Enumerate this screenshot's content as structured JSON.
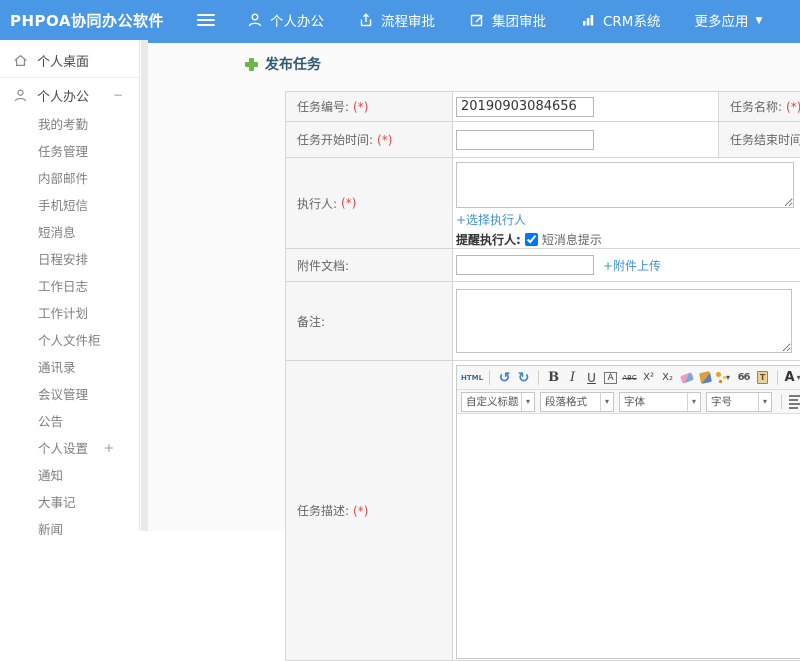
{
  "header": {
    "logo": "PHPOA协同办公软件",
    "nav": [
      {
        "label": "个人办公",
        "icon": "person-icon"
      },
      {
        "label": "流程审批",
        "icon": "approval-flow-icon"
      },
      {
        "label": "集团审批",
        "icon": "group-approval-icon"
      },
      {
        "label": "CRM系统",
        "icon": "bar-chart-icon"
      },
      {
        "label": "更多应用",
        "icon": "caret-down-icon"
      }
    ]
  },
  "sidebar": {
    "items": [
      {
        "label": "个人桌面",
        "icon": "home",
        "level": 0
      },
      {
        "label": "个人办公",
        "icon": "person",
        "level": 0,
        "toggle": "−"
      },
      {
        "label": "我的考勤",
        "level": 1
      },
      {
        "label": "任务管理",
        "level": 1
      },
      {
        "label": "内部邮件",
        "level": 1
      },
      {
        "label": "手机短信",
        "level": 1
      },
      {
        "label": "短消息",
        "level": 1
      },
      {
        "label": "日程安排",
        "level": 1
      },
      {
        "label": "工作日志",
        "level": 1
      },
      {
        "label": "工作计划",
        "level": 1
      },
      {
        "label": "个人文件柜",
        "level": 1
      },
      {
        "label": "通讯录",
        "level": 1
      },
      {
        "label": "会议管理",
        "level": 1
      },
      {
        "label": "公告",
        "level": 1
      },
      {
        "label": "个人设置",
        "level": 1,
        "toggle": "+"
      },
      {
        "label": "通知",
        "level": 1
      },
      {
        "label": "大事记",
        "level": 1
      },
      {
        "label": "新闻",
        "level": 1
      }
    ]
  },
  "main": {
    "title": "发布任务",
    "required_mark": "(*)",
    "form": {
      "task_no": {
        "label": "任务编号:",
        "value": "20190903084656"
      },
      "task_name": {
        "label": "任务名称:"
      },
      "start_time": {
        "label": "任务开始时间:"
      },
      "end_time": {
        "label": "任务结束时间:"
      },
      "executor": {
        "label": "执行人:",
        "choose_link": "+选择执行人",
        "remind_label": "提醒执行人:",
        "sms_label": "短消息提示"
      },
      "attachment": {
        "label": "附件文档:",
        "upload_link": "+附件上传"
      },
      "remark": {
        "label": "备注:"
      },
      "description": {
        "label": "任务描述:"
      }
    },
    "editor": {
      "toolbar_icons": [
        {
          "name": "html-source",
          "label": "HTML"
        },
        {
          "name": "separator"
        },
        {
          "name": "undo"
        },
        {
          "name": "redo"
        },
        {
          "name": "separator"
        },
        {
          "name": "bold"
        },
        {
          "name": "italic"
        },
        {
          "name": "underline"
        },
        {
          "name": "font-border"
        },
        {
          "name": "strikethrough"
        },
        {
          "name": "superscript"
        },
        {
          "name": "subscript"
        },
        {
          "name": "eraser"
        },
        {
          "name": "format-brush"
        },
        {
          "name": "highlight",
          "caret": true
        },
        {
          "name": "blockquote"
        },
        {
          "name": "paste-text"
        },
        {
          "name": "separator"
        },
        {
          "name": "font-color",
          "caret": true
        }
      ],
      "dropdowns": [
        "自定义标题",
        "段落格式",
        "字体",
        "字号"
      ],
      "align_icons": [
        "align-left",
        "align-center",
        "align-right",
        "align-justify"
      ]
    }
  }
}
